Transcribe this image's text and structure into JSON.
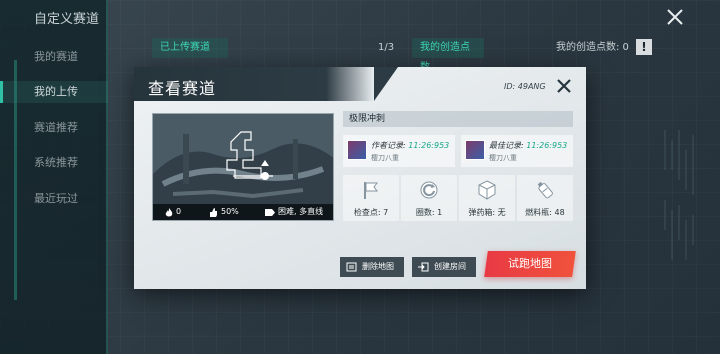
{
  "page": {
    "title": "自定义赛道",
    "sidebar": {
      "items": [
        {
          "label": "我的赛道"
        },
        {
          "label": "我的上传"
        },
        {
          "label": "赛道推荐"
        },
        {
          "label": "系统推荐"
        },
        {
          "label": "最近玩过"
        }
      ],
      "active_index": 1
    },
    "tabs": {
      "uploaded_label": "已上传赛道",
      "count": "1/3",
      "creation_points_tab": "我的创造点数",
      "creation_points_text": "我的创造点数: 0"
    }
  },
  "modal": {
    "title": "查看赛道",
    "id": "ID: 49ANG",
    "track_name": "极限冲刺",
    "preview": {
      "likes_stat": "0",
      "completion": "50%",
      "difficulty": "困难, 多直线"
    },
    "records": {
      "author": {
        "label": "作者记录:",
        "time": "11:26:953",
        "player": "樱刀八重"
      },
      "best": {
        "label": "最佳记录:",
        "time": "11:26:953",
        "player": "樱刀八重"
      }
    },
    "stats": [
      {
        "label": "检查点: 7",
        "icon": "flag-icon"
      },
      {
        "label": "圈数: 1",
        "icon": "laps-icon"
      },
      {
        "label": "弹药箱: 无",
        "icon": "ammo-box-icon"
      },
      {
        "label": "燃料瓶: 48",
        "icon": "fuel-bottle-icon"
      }
    ],
    "buttons": {
      "delete": "删除地图",
      "create_room": "创建房间",
      "try_map": "试跑地图"
    }
  },
  "colors": {
    "accent": "#2fc2a6",
    "record_time": "#18a58b",
    "primary_button": "#e83a44"
  }
}
